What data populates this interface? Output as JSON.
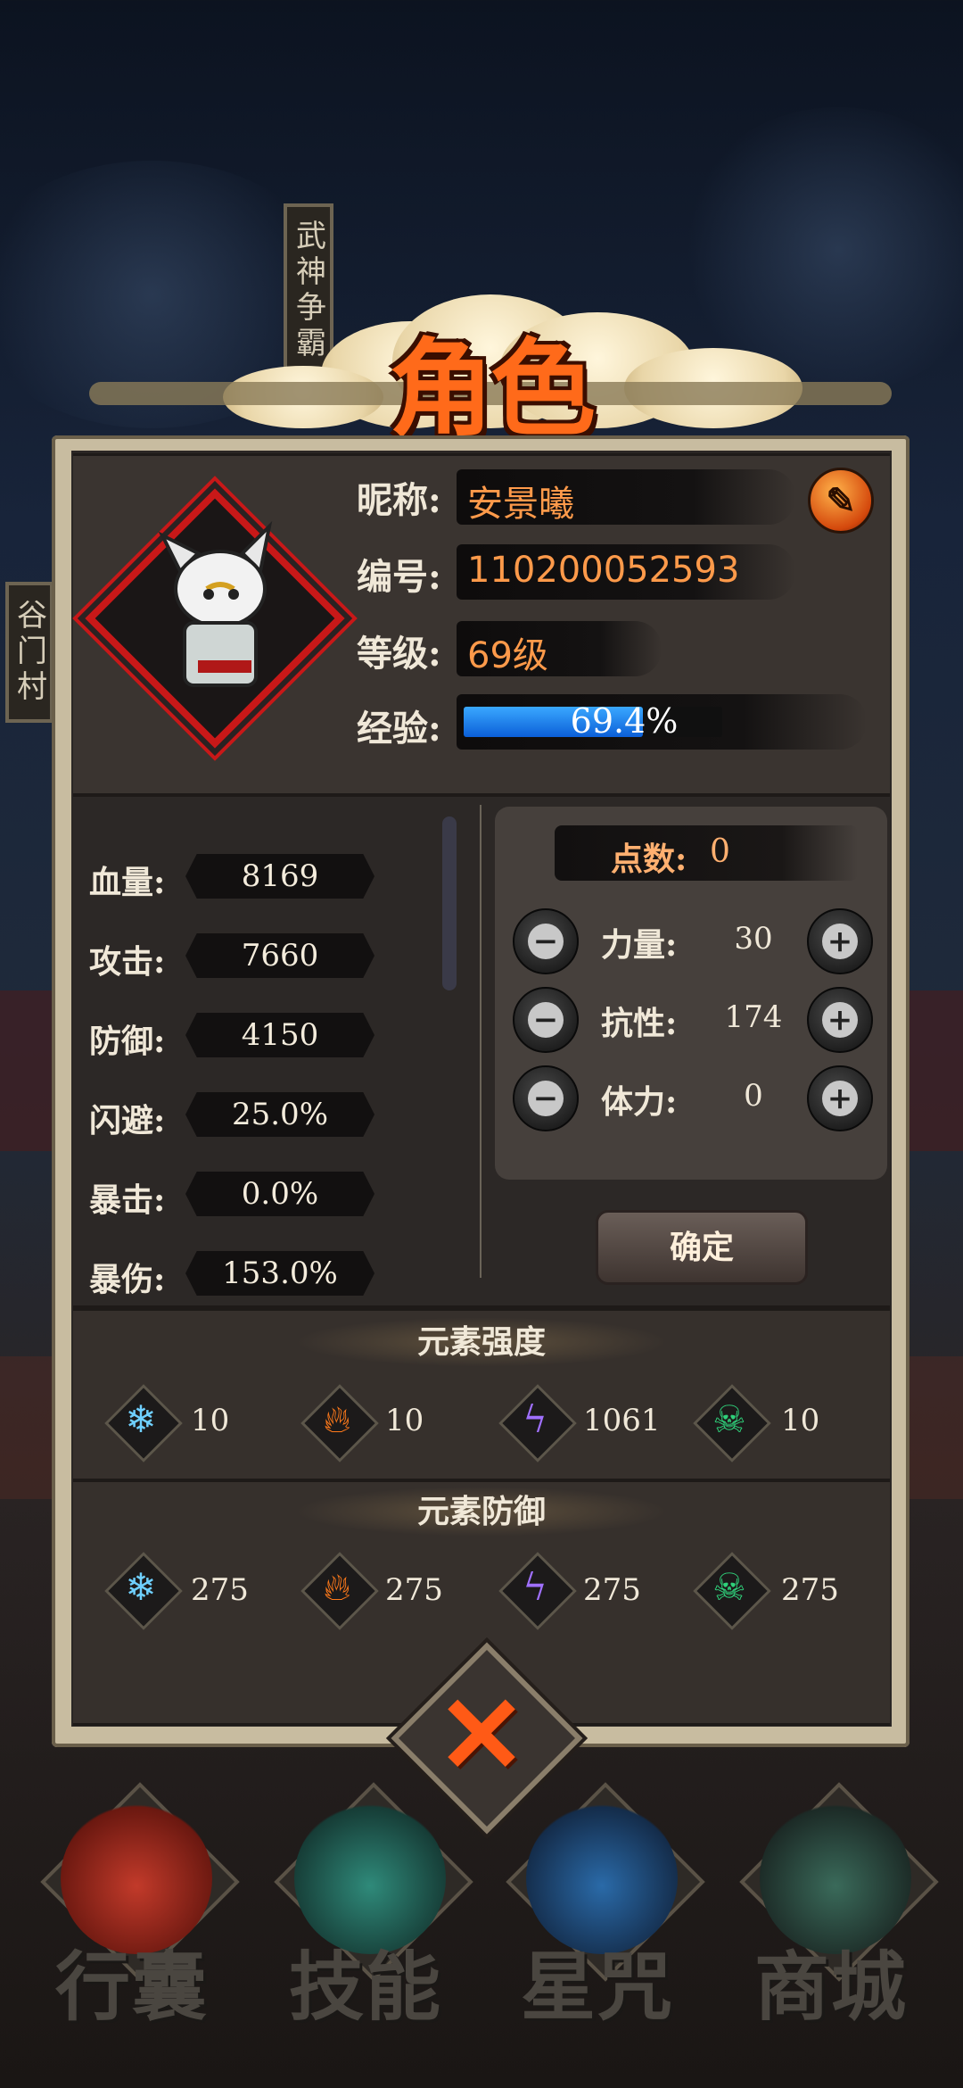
{
  "side_signs": {
    "top": "武神争霸",
    "left": "谷门村"
  },
  "title": "角色",
  "profile": {
    "nickname_label": "昵称:",
    "nickname": "安景曦",
    "id_label": "编号:",
    "id": "110200052593",
    "level_label": "等级:",
    "level": "69级",
    "exp_label": "经验:",
    "exp_text": "69.4%",
    "exp_fraction": 0.694,
    "edit_icon": "pencil-icon"
  },
  "stats": [
    {
      "label": "血量:",
      "value": "8169"
    },
    {
      "label": "攻击:",
      "value": "7660"
    },
    {
      "label": "防御:",
      "value": "4150"
    },
    {
      "label": "闪避:",
      "value": "25.0%"
    },
    {
      "label": "暴击:",
      "value": "0.0%"
    },
    {
      "label": "暴伤:",
      "value": "153.0%"
    }
  ],
  "points": {
    "label": "点数:",
    "value": "0",
    "attributes": [
      {
        "label": "力量:",
        "value": "30"
      },
      {
        "label": "抗性:",
        "value": "174"
      },
      {
        "label": "体力:",
        "value": "0"
      }
    ],
    "confirm_label": "确定"
  },
  "element_strength": {
    "title": "元素强度",
    "items": [
      {
        "icon": "ice-icon",
        "value": "10"
      },
      {
        "icon": "fire-icon",
        "value": "10"
      },
      {
        "icon": "lightning-icon",
        "value": "1061"
      },
      {
        "icon": "poison-skull-icon",
        "value": "10"
      }
    ]
  },
  "element_defense": {
    "title": "元素防御",
    "items": [
      {
        "icon": "ice-icon",
        "value": "275"
      },
      {
        "icon": "fire-icon",
        "value": "275"
      },
      {
        "icon": "lightning-icon",
        "value": "275"
      },
      {
        "icon": "poison-skull-icon",
        "value": "275"
      }
    ]
  },
  "nav": [
    {
      "label": "行囊",
      "icon": "bag-icon"
    },
    {
      "label": "技能",
      "icon": "skill-icon"
    },
    {
      "label": "星咒",
      "icon": "star-scroll-icon"
    },
    {
      "label": "商城",
      "icon": "shop-icon"
    }
  ],
  "colors": {
    "accent_orange": "#ff9a4a",
    "title_orange": "#ff6a1a",
    "exp_blue": "#3aa8ff",
    "frame_red": "#c81818"
  }
}
